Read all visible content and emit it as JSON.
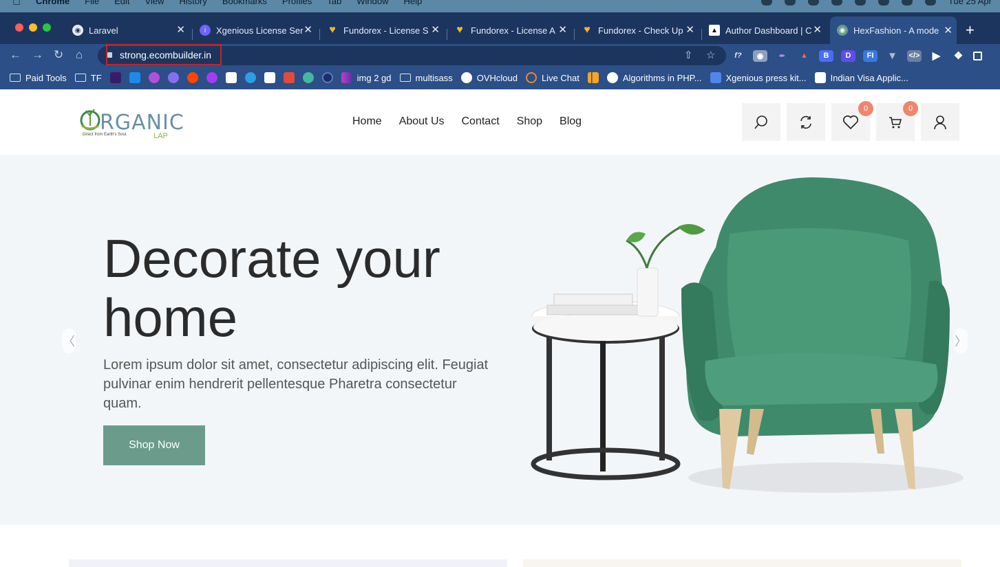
{
  "mac_menu": {
    "items": [
      "Chrome",
      "File",
      "Edit",
      "View",
      "History",
      "Bookmarks",
      "Profiles",
      "Tab",
      "Window",
      "Help"
    ],
    "clock": "Tue 25 Apr"
  },
  "tabs": [
    {
      "title": "Laravel",
      "favicon": "globe-icon",
      "color": "#2b4f86"
    },
    {
      "title": "Xgenious License Ser",
      "favicon": "info-icon",
      "color": "#6c63ff"
    },
    {
      "title": "Fundorex - License S",
      "favicon": "heart-icon",
      "color": "#f5b335"
    },
    {
      "title": "Fundorex - License A",
      "favicon": "heart-icon",
      "color": "#f5b335"
    },
    {
      "title": "Fundorex - Check Up",
      "favicon": "heart-icon",
      "color": "#f5b335"
    },
    {
      "title": "Author Dashboard | C",
      "favicon": "author-icon",
      "color": "#ffffff"
    },
    {
      "title": "HexFashion - A mode",
      "favicon": "globe-icon",
      "color": "#6a9b8b"
    }
  ],
  "address_bar": {
    "url": "strong.ecombuilder.in"
  },
  "bookmarks": [
    {
      "label": "Paid Tools",
      "icon": "folder-icon"
    },
    {
      "label": "TF",
      "icon": "folder-icon"
    },
    {
      "label": "",
      "icon": "x-icon",
      "color": "#3a1b6b"
    },
    {
      "label": "",
      "icon": "chat-icon",
      "color": "#1d8ae8"
    },
    {
      "label": "",
      "icon": "x-logo-icon",
      "color": "#b44fdb"
    },
    {
      "label": "",
      "icon": "bird-icon",
      "color": "#8b6cf0"
    },
    {
      "label": "",
      "icon": "reddit-icon",
      "color": "#ff4500"
    },
    {
      "label": "",
      "icon": "messenger-icon",
      "color": "#a33cf3"
    },
    {
      "label": "",
      "icon": "author-icon",
      "color": "#ffffff"
    },
    {
      "label": "",
      "icon": "swirl-icon",
      "color": "#2d9de6"
    },
    {
      "label": "",
      "icon": "cl-icon",
      "color": "#ffffff"
    },
    {
      "label": "",
      "icon": "it-icon",
      "color": "#e04b3c"
    },
    {
      "label": "",
      "icon": "cloud-icon",
      "color": "#46b6a0"
    },
    {
      "label": "",
      "icon": "circle-icon",
      "color": "#1b2e66"
    },
    {
      "label": "img 2 gd",
      "icon": "gradient-icon",
      "color": "#c23cc7"
    },
    {
      "label": "multisass",
      "icon": "folder-icon"
    },
    {
      "label": "OVHcloud",
      "icon": "ovh-icon",
      "color": "#ffffff"
    },
    {
      "label": "Live Chat",
      "icon": "livechat-icon",
      "color": "#f0862f"
    },
    {
      "label": "",
      "icon": "bars-icon",
      "color": "#f4a623"
    },
    {
      "label": "Algorithms in PHP...",
      "icon": "wordpress-icon",
      "color": "#ffffff"
    },
    {
      "label": "Xgenious press kit...",
      "icon": "doc-icon",
      "color": "#4f86ec"
    },
    {
      "label": "Indian Visa Applic...",
      "icon": "nic-icon",
      "color": "#ffffff"
    }
  ],
  "site": {
    "logo_text": "RGANIC",
    "logo_tagline": "Direct from Earth's Soul.",
    "logo_sub": "LAP",
    "nav": [
      "Home",
      "About Us",
      "Contact",
      "Shop",
      "Blog"
    ],
    "wishlist_count": "0",
    "cart_count": "0"
  },
  "hero": {
    "title_line1": "Decorate your",
    "title_line2": "home",
    "text": "Lorem ipsum dolor sit amet, consectetur adipiscing elit. Feugiat pulvinar enim hendrerit pellentesque Pharetra consectetur quam.",
    "button": "Shop Now",
    "prev_arrow": "〈",
    "next_arrow": "〉"
  },
  "colors": {
    "chrome_bg": "#1c355e",
    "toolbar_bg": "#2b4f86",
    "accent": "#6a9b8b",
    "badge": "#f0856b",
    "hero_bg": "#f3f6f9"
  }
}
